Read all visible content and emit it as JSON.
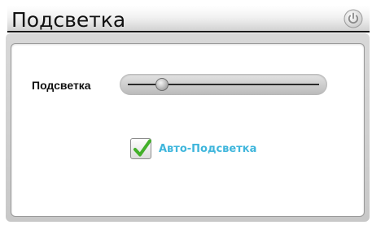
{
  "header": {
    "title": "Подсветка",
    "power_icon": "power-icon"
  },
  "backlight": {
    "label": "Подсветка",
    "level_fraction": 0.18
  },
  "auto_backlight": {
    "label": "Авто-Подсветка",
    "checked": true,
    "checkbox_icon": "checkmark-icon"
  },
  "colors": {
    "accent_label": "#3fb6dc",
    "checkmark": "#43b02a",
    "title_underline": "#1a1a1a"
  }
}
